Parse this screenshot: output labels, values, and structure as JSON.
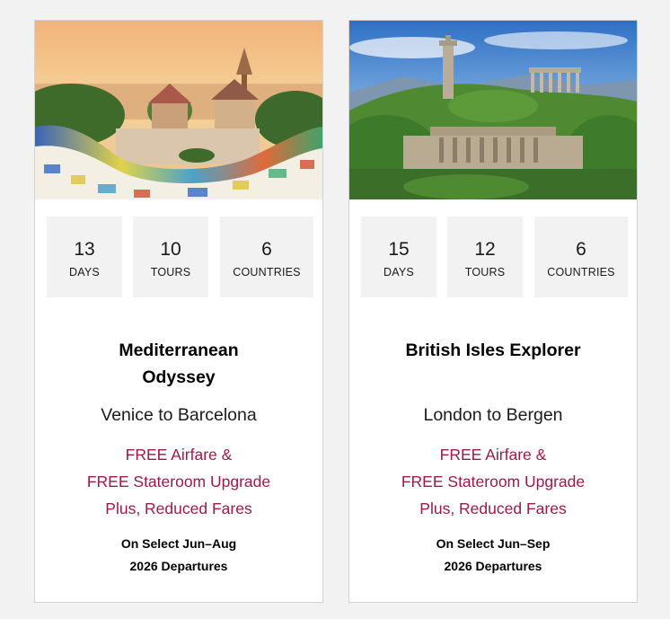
{
  "cards": [
    {
      "image_alt": "Park Güell mosaic bench overlooking Barcelona at sunset",
      "stats": [
        {
          "value": "13",
          "label": "DAYS"
        },
        {
          "value": "10",
          "label": "TOURS"
        },
        {
          "value": "6",
          "label": "COUNTRIES"
        }
      ],
      "title_line1": "Mediterranean",
      "title_line2": "Odyssey",
      "route": "Venice to Barcelona",
      "promo": [
        "FREE Airfare &",
        "FREE Stateroom Upgrade",
        "Plus, Reduced Fares"
      ],
      "departures_line1": "On Select Jun–Aug",
      "departures_line2": "2026 Departures"
    },
    {
      "image_alt": "Calton Hill monuments in Edinburgh",
      "stats": [
        {
          "value": "15",
          "label": "DAYS"
        },
        {
          "value": "12",
          "label": "TOURS"
        },
        {
          "value": "6",
          "label": "COUNTRIES"
        }
      ],
      "title_line1": "British Isles Explorer",
      "title_line2": "",
      "route": "London to Bergen",
      "promo": [
        "FREE Airfare &",
        "FREE Stateroom Upgrade",
        "Plus, Reduced Fares"
      ],
      "departures_line1": "On Select Jun–Sep",
      "departures_line2": "2026 Departures"
    }
  ],
  "colors": {
    "page_background": "#f2f2f2",
    "card_background": "#ffffff",
    "stat_background": "#f2f2f2",
    "promo_text": "#9a1b48"
  }
}
